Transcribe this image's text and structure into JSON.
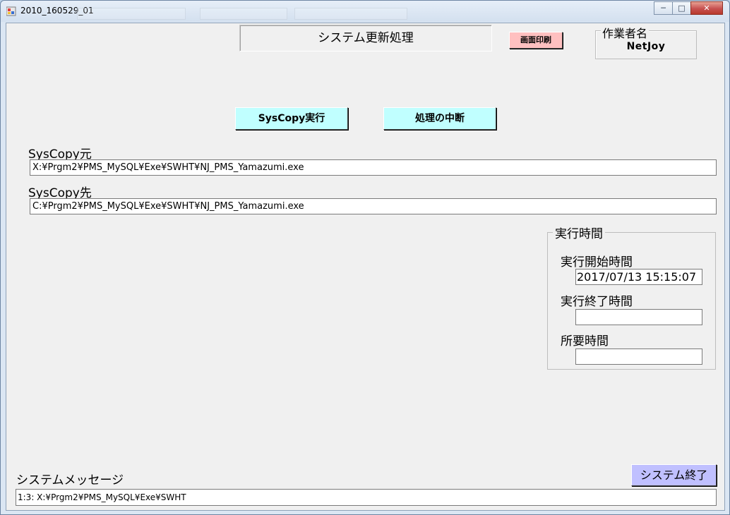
{
  "window": {
    "title": "2010_160529_01",
    "controls": {
      "minimize": "─",
      "maximize": "□",
      "close": "✕"
    }
  },
  "header": {
    "title": "システム更新処理",
    "print_button": "画面印刷"
  },
  "worker": {
    "legend": "作業者名",
    "name": "NetJoy"
  },
  "actions": {
    "run_button": "SysCopy実行",
    "abort_button": "処理の中断"
  },
  "source": {
    "label": "SysCopy元",
    "value": "X:¥Prgm2¥PMS_MySQL¥Exe¥SWHT¥NJ_PMS_Yamazumi.exe"
  },
  "destination": {
    "label": "SysCopy先",
    "value": "C:¥Prgm2¥PMS_MySQL¥Exe¥SWHT¥NJ_PMS_Yamazumi.exe"
  },
  "timing": {
    "legend": "実行時間",
    "start_label": "実行開始時間",
    "start_value": "2017/07/13 15:15:07",
    "end_label": "実行終了時間",
    "end_value": "",
    "duration_label": "所要時間",
    "duration_value": ""
  },
  "footer": {
    "message_label": "システムメッセージ",
    "message_value": "1:3:   X:¥Prgm2¥PMS_MySQL¥Exe¥SWHT",
    "exit_button": "システム終了"
  },
  "colors": {
    "cyan_button": "#c0ffff",
    "print_button": "#ffc0c0",
    "exit_button": "#c0c0ff"
  }
}
